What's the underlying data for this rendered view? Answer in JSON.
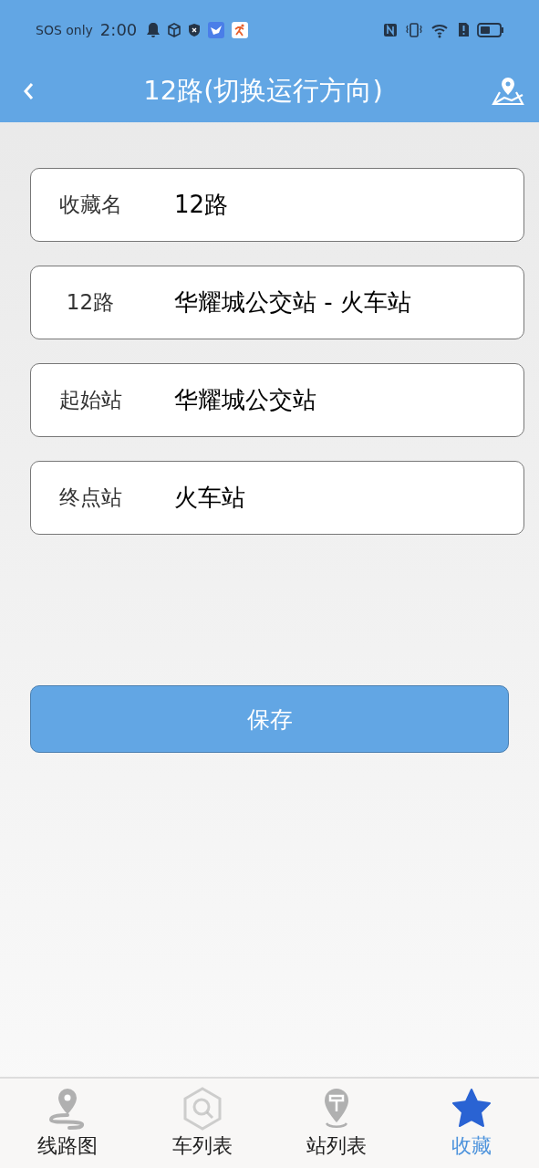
{
  "status_bar": {
    "carrier": "SOS only",
    "time": "2:00"
  },
  "title_bar": {
    "title": "12路(切换运行方向)"
  },
  "fields": [
    {
      "label": "收藏名",
      "value": "12路"
    },
    {
      "label": "12路",
      "value": "华耀城公交站 - 火车站"
    },
    {
      "label": "起始站",
      "value": "华耀城公交站"
    },
    {
      "label": "终点站",
      "value": "火车站"
    }
  ],
  "save_button": "保存",
  "tabs": [
    {
      "label": "线路图",
      "kind": "route",
      "selected": false
    },
    {
      "label": "车列表",
      "kind": "search",
      "selected": false
    },
    {
      "label": "站列表",
      "kind": "stop",
      "selected": false
    },
    {
      "label": "收藏",
      "kind": "star",
      "selected": true
    }
  ]
}
